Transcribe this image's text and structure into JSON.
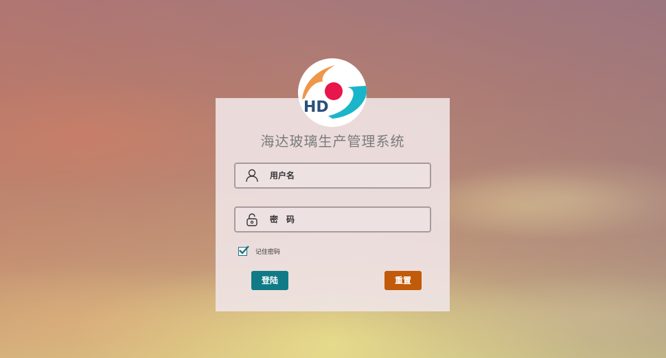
{
  "app": {
    "title": "海达玻璃生产管理系统",
    "logo_text": "HD"
  },
  "form": {
    "username": {
      "placeholder": "用户名",
      "value": "",
      "icon": "user-icon"
    },
    "password": {
      "placeholder": "密　码",
      "value": "",
      "icon": "lock-icon"
    },
    "remember": {
      "label": "记住密码",
      "checked": true
    }
  },
  "buttons": {
    "login_label": "登陆",
    "reset_label": "重置"
  },
  "colors": {
    "login_button": "#107a86",
    "reset_button": "#c15a0a",
    "logo_orange": "#f0964a",
    "logo_red": "#e8164a",
    "logo_cyan": "#1bb5c9",
    "logo_text": "#2b4f7a"
  }
}
